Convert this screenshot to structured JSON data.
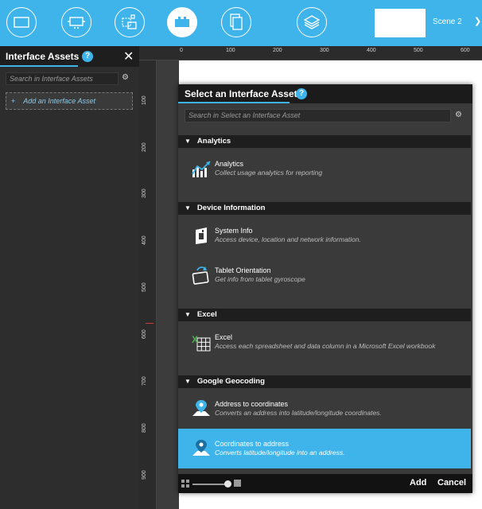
{
  "toolbar": {
    "buttons": [
      {
        "icon": "screen-icon"
      },
      {
        "icon": "device-icon"
      },
      {
        "icon": "components-icon"
      },
      {
        "icon": "interface-assets-icon",
        "active": true
      },
      {
        "icon": "pages-icon"
      },
      {
        "icon": "layers-icon"
      }
    ],
    "scene_label": "Scene 2",
    "chevron": "❯"
  },
  "left_panel": {
    "title": "Interface Assets",
    "help": "?",
    "close": "✕",
    "search_placeholder": "Search in  Interface Assets",
    "add_label": "Add an Interface Asset",
    "add_plus": "+"
  },
  "ruler": {
    "top_ticks": [
      "0",
      "100",
      "200",
      "300",
      "400",
      "500",
      "600"
    ],
    "left_ticks": [
      "100",
      "200",
      "300",
      "400",
      "500",
      "600",
      "700",
      "800",
      "900"
    ]
  },
  "dialog": {
    "title": "Select an Interface Asset",
    "help": "?",
    "search_placeholder": "Search in  Select an Interface Asset",
    "sections": [
      {
        "label": "Analytics",
        "items": [
          {
            "name": "Analytics",
            "desc": "Collect usage analytics for reporting",
            "icon": "analytics-chart-icon"
          }
        ]
      },
      {
        "label": "Device Information",
        "items": [
          {
            "name": "System Info",
            "desc": "Access device, location and network information.",
            "icon": "system-info-icon"
          },
          {
            "name": "Tablet Orientation",
            "desc": "Get info from tablet gyroscope",
            "icon": "tablet-orientation-icon"
          }
        ]
      },
      {
        "label": "Excel",
        "items": [
          {
            "name": "Excel",
            "desc": "Access each spreadsheet and data column in a Microsoft Excel workbook",
            "icon": "excel-icon"
          }
        ]
      },
      {
        "label": "Google Geocoding",
        "items": [
          {
            "name": "Address to coordinates",
            "desc": "Converts an address into latitude/longitude coordinates.",
            "icon": "map-pin-icon"
          },
          {
            "name": "Coordinates to address",
            "desc": "Converts latitude/longitude into an address.",
            "icon": "map-pin-icon",
            "selected": true
          }
        ]
      }
    ],
    "add_label": "Add",
    "cancel_label": "Cancel"
  },
  "colors": {
    "accent": "#3fb4ea",
    "panel": "#2d2d2d",
    "header": "#1e1e1e"
  }
}
